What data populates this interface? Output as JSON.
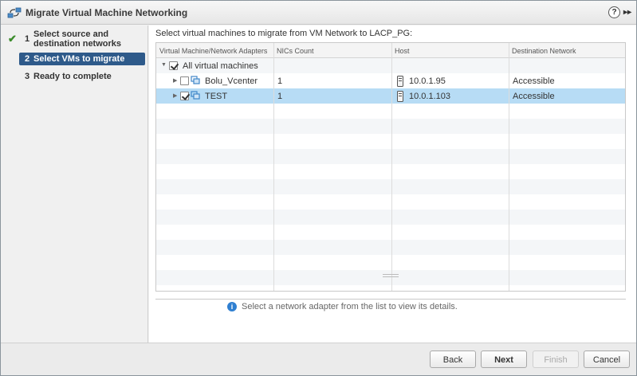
{
  "window": {
    "title": "Migrate Virtual Machine Networking",
    "help_label": "?",
    "expand_label": "▸▸"
  },
  "wizard": {
    "steps": [
      {
        "number": "1",
        "label_line1": "Select source and",
        "label_line2": "destination networks",
        "completed": true
      },
      {
        "number": "2",
        "label": "Select VMs to migrate",
        "active": true
      },
      {
        "number": "3",
        "label": "Ready to complete"
      }
    ],
    "check_glyph": "✔"
  },
  "main": {
    "instruction": "Select virtual machines to migrate from VM Network to LACP_PG:",
    "columns": [
      "Virtual Machine/Network Adapters",
      "NICs Count",
      "Host",
      "Destination Network"
    ],
    "root": {
      "label": "All virtual machines",
      "checked": true
    },
    "rows": [
      {
        "name": "Bolu_Vcenter",
        "nics": "1",
        "host": "10.0.1.95",
        "destination": "Accessible",
        "checked": false,
        "selected": false
      },
      {
        "name": "TEST",
        "nics": "1",
        "host": "10.0.1.103",
        "destination": "Accessible",
        "checked": true,
        "selected": true
      }
    ],
    "detail_hint": "Select a network adapter from the list to view its details.",
    "info_glyph": "i"
  },
  "footer": {
    "back": "Back",
    "next": "Next",
    "finish": "Finish",
    "cancel": "Cancel"
  },
  "colors": {
    "active_step": "#2e5a8a",
    "selected_row": "#b7dcf5",
    "check": "#3c8c2c",
    "info": "#2f7fd1"
  }
}
